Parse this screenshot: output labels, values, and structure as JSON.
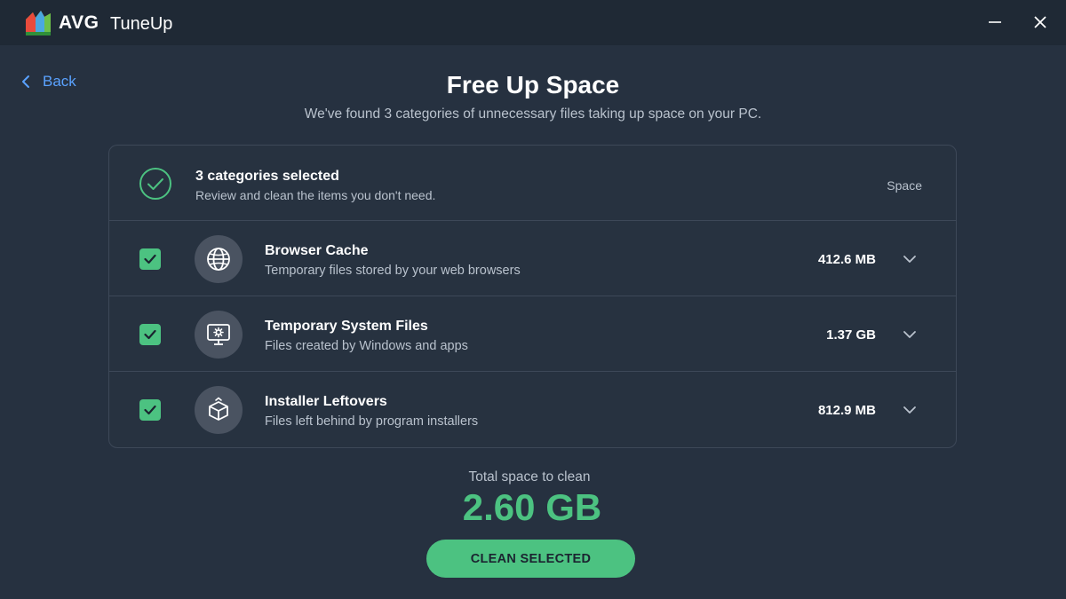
{
  "titlebar": {
    "logo_text": "AVG",
    "app_name": "TuneUp"
  },
  "back": {
    "label": "Back"
  },
  "page": {
    "title": "Free Up Space",
    "subtitle": "We've found 3 categories of unnecessary files taking up space on your PC."
  },
  "panel": {
    "header": {
      "title": "3 categories selected",
      "subtitle": "Review and clean the items you don't need.",
      "space_label": "Space"
    },
    "rows": [
      {
        "title": "Browser Cache",
        "subtitle": "Temporary files stored by your web browsers",
        "size": "412.6 MB",
        "icon": "globe-icon",
        "checked": true
      },
      {
        "title": "Temporary System Files",
        "subtitle": "Files created by Windows and apps",
        "size": "1.37 GB",
        "icon": "monitor-gear-icon",
        "checked": true
      },
      {
        "title": "Installer Leftovers",
        "subtitle": "Files left behind by program installers",
        "size": "812.9 MB",
        "icon": "package-icon",
        "checked": true
      }
    ]
  },
  "total": {
    "label": "Total space to clean",
    "value": "2.60 GB"
  },
  "action": {
    "clean_label": "CLEAN SELECTED"
  },
  "colors": {
    "accent_green": "#4cc281",
    "link_blue": "#5aa2ff",
    "background": "#263140",
    "titlebar": "#1f2935"
  }
}
